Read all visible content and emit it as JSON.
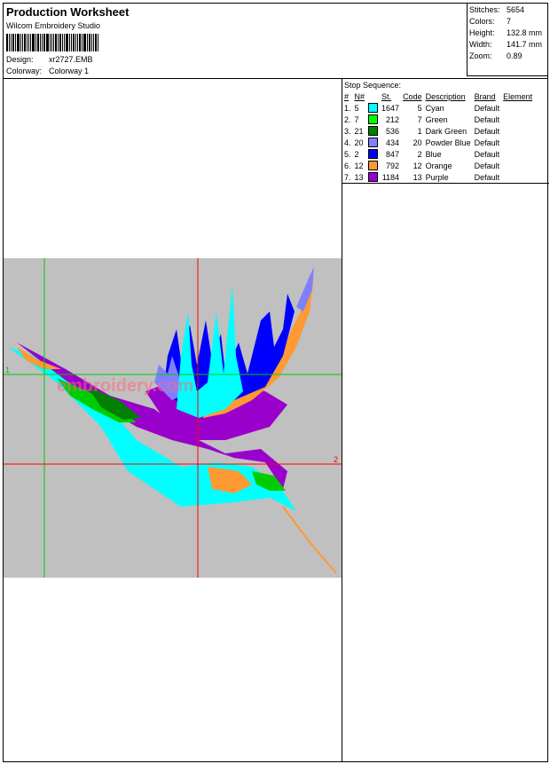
{
  "header": {
    "title": "Production Worksheet",
    "software": "Wilcom  Embroidery Studio",
    "design_label": "Design:",
    "design_value": "xr2727.EMB",
    "colorway_label": "Colorway:",
    "colorway_value": "Colorway 1"
  },
  "stats": [
    {
      "label": "Stitches:",
      "value": "5654"
    },
    {
      "label": "Colors:",
      "value": "7"
    },
    {
      "label": "Height:",
      "value": "132.8 mm"
    },
    {
      "label": "Width:",
      "value": "141.7 mm"
    },
    {
      "label": "Zoom:",
      "value": "0.89"
    }
  ],
  "stop_sequence": {
    "title": "Stop Sequence:",
    "headers": [
      "#",
      "N#",
      "St.",
      "Code",
      "Description",
      "Brand",
      "Element"
    ],
    "rows": [
      {
        "idx": "1.",
        "n": "5",
        "color": "#00ffff",
        "st": "1647",
        "code": "5",
        "desc": "Cyan",
        "brand": "Default"
      },
      {
        "idx": "2.",
        "n": "7",
        "color": "#00ff00",
        "st": "212",
        "code": "7",
        "desc": "Green",
        "brand": "Default"
      },
      {
        "idx": "3.",
        "n": "21",
        "color": "#008000",
        "st": "536",
        "code": "1",
        "desc": "Dark Green",
        "brand": "Default"
      },
      {
        "idx": "4.",
        "n": "20",
        "color": "#8080ff",
        "st": "434",
        "code": "20",
        "desc": "Powder Blue",
        "brand": "Default"
      },
      {
        "idx": "5.",
        "n": "2",
        "color": "#0000ff",
        "st": "847",
        "code": "2",
        "desc": "Blue",
        "brand": "Default"
      },
      {
        "idx": "6.",
        "n": "12",
        "color": "#ff9933",
        "st": "792",
        "code": "12",
        "desc": "Orange",
        "brand": "Default"
      },
      {
        "idx": "7.",
        "n": "13",
        "color": "#9900cc",
        "st": "1184",
        "code": "13",
        "desc": "Purple",
        "brand": "Default"
      }
    ]
  },
  "preview": {
    "marker_1": "1",
    "marker_2": "2",
    "watermark": "embroidery.com",
    "guide_green": "#00cc00",
    "guide_red": "#ff0000"
  }
}
